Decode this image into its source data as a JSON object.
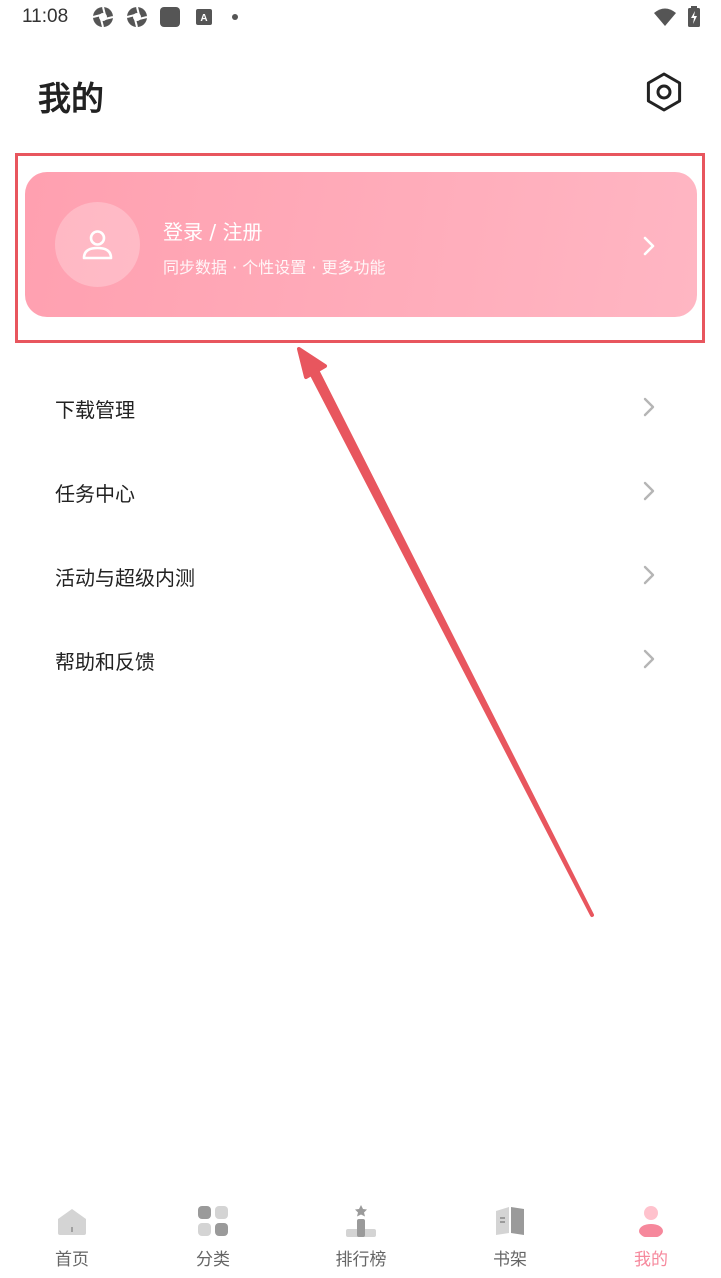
{
  "status_bar": {
    "time": "11:08",
    "icons": [
      "aperture-icon",
      "aperture-icon",
      "square-icon",
      "a-icon",
      "dot-icon",
      "wifi-icon",
      "battery-icon"
    ]
  },
  "header": {
    "title": "我的",
    "settings_icon": "gear-icon"
  },
  "login_card": {
    "title": "登录 / 注册",
    "subtitle": "同步数据 · 个性设置 · 更多功能",
    "avatar_icon": "user-icon",
    "chevron_icon": "chevron-right-icon"
  },
  "menu": {
    "items": [
      {
        "label": "下载管理"
      },
      {
        "label": "任务中心"
      },
      {
        "label": "活动与超级内测"
      },
      {
        "label": "帮助和反馈"
      }
    ]
  },
  "bottom_nav": {
    "items": [
      {
        "label": "首页",
        "icon": "home-icon"
      },
      {
        "label": "分类",
        "icon": "category-grid-icon"
      },
      {
        "label": "排行榜",
        "icon": "ranking-icon"
      },
      {
        "label": "书架",
        "icon": "bookshelf-icon"
      },
      {
        "label": "我的",
        "icon": "profile-icon",
        "active": true
      }
    ]
  },
  "colors": {
    "accent": "#f6889c",
    "card_gradient_start": "#ffa0b0",
    "card_gradient_end": "#ffb6c3",
    "annotation_red": "#e8565e"
  }
}
